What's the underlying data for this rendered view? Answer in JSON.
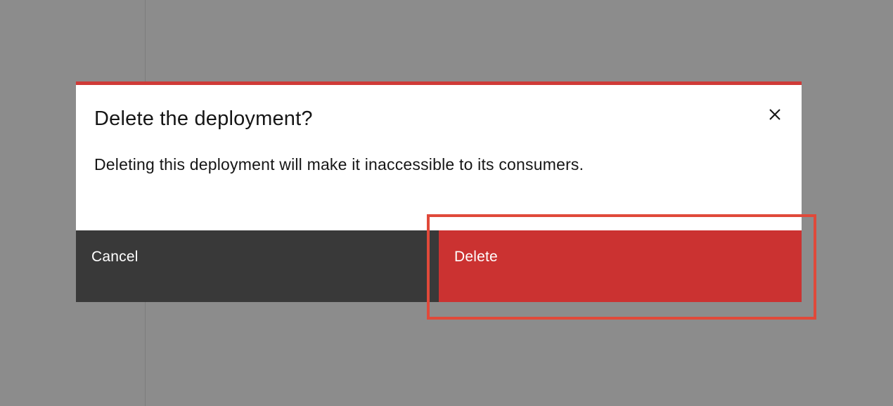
{
  "modal": {
    "title": "Delete the deployment?",
    "body": "Deleting this deployment will make it inaccessible to its consumers.",
    "close_icon": "close-icon",
    "accent_color": "#cf3a37"
  },
  "footer": {
    "cancel_label": "Cancel",
    "delete_label": "Delete"
  },
  "colors": {
    "overlay": "#8c8c8c",
    "cancel_bg": "#393939",
    "delete_bg": "#cb3231",
    "highlight": "#e0493a"
  }
}
